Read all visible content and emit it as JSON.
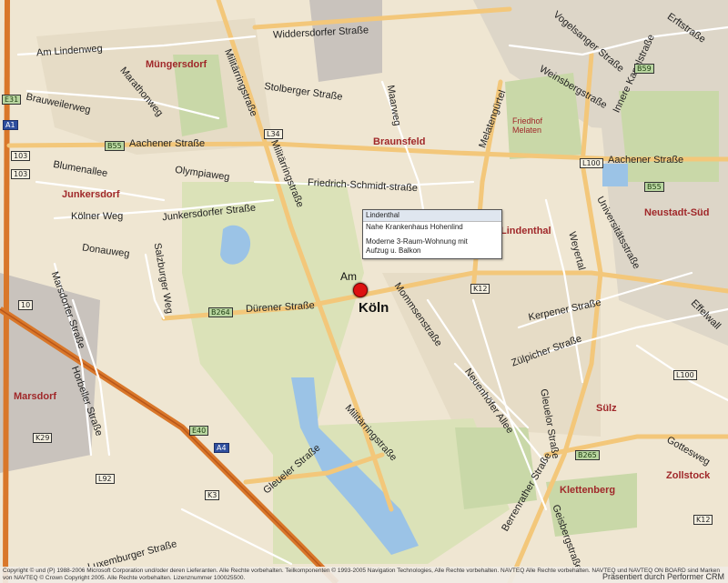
{
  "colors": {
    "land": "#efe6d2",
    "park": "#c9d8a8",
    "urban": "#c9c3bd",
    "water": "#9bc3e6",
    "major_road": "#f3c77a",
    "minor_road": "#ffffff",
    "highway": "#d9772a",
    "district_label": "#a0282a"
  },
  "streets": [
    "Widdersdorfer Straße",
    "Am Lindenweg",
    "Marathonweg",
    "Brauweilerweg",
    "Militärringstraße",
    "Stolberger Straße",
    "Maarweg",
    "Aachener Straße",
    "Olympiaweg",
    "Blumenallee",
    "Friedrich-Schmidt-straße",
    "Junkersdorfer Straße",
    "Kölner Weg",
    "Donauweg",
    "Salzburger Weg",
    "Dürener Straße",
    "Mommsenstraße",
    "Gleueler Straße",
    "Kerpener Straße",
    "Zülpicher Straße",
    "Weyertal",
    "Universitätsstraße",
    "Neuenhöfer Allee",
    "Berrenrather Straße",
    "Gottesweg",
    "Effelwall",
    "Vogelsanger Straße",
    "Weinsbergstraße",
    "Innere Kanalstraße",
    "Melatengürtel",
    "Horbeller Straße",
    "Marsdorfer Straße",
    "Luxemburger Straße",
    "Erftstraße",
    "Gleuelor Straße",
    "Geisbergstraße",
    "Militärringstraße",
    "Militärringstraße",
    "Aachener Straße"
  ],
  "districts": [
    "Müngersdorf",
    "Braunsfeld",
    "Junkersdorf",
    "Lindenthal",
    "Neustadt-Süd",
    "Marsdorf",
    "Sülz",
    "Klettenberg",
    "Zollstock",
    "Friedhof Melaten"
  ],
  "shields": [
    {
      "label": "E31",
      "style": "g"
    },
    {
      "label": "A1",
      "style": "b"
    },
    {
      "label": "103",
      "style": "w"
    },
    {
      "label": "103",
      "style": "w"
    },
    {
      "label": "B55",
      "style": "g"
    },
    {
      "label": "B55",
      "style": "g"
    },
    {
      "label": "L34",
      "style": "w"
    },
    {
      "label": "L100",
      "style": "w"
    },
    {
      "label": "B59",
      "style": "g"
    },
    {
      "label": "B264",
      "style": "g"
    },
    {
      "label": "K12",
      "style": "w"
    },
    {
      "label": "10",
      "style": "w"
    },
    {
      "label": "E40",
      "style": "g"
    },
    {
      "label": "A4",
      "style": "b"
    },
    {
      "label": "K29",
      "style": "w"
    },
    {
      "label": "L92",
      "style": "w"
    },
    {
      "label": "K3",
      "style": "w"
    },
    {
      "label": "L100",
      "style": "w"
    },
    {
      "label": "B265",
      "style": "g"
    },
    {
      "label": "K12",
      "style": "w"
    }
  ],
  "marker": {
    "city": "Köln",
    "am_label": "Am",
    "popup_title": "Lindenthal",
    "popup_line1": "Nahe Krankenhaus Hohenlind",
    "popup_line2": "Moderne 3-Raum-Wohnung mit",
    "popup_line3": "Aufzug u. Balkon"
  },
  "footer": {
    "copyright": "Copyright © und (P) 1988-2006 Microsoft Corporation und/oder deren Lieferanten. Alle Rechte vorbehalten. Teilkomponenten © 1993-2005 Navigation Technologies, Alle Rechte vorbehalten. NAVTEQ Alle Rechte vorbehalten. NAVTEQ und NAVTEQ ON BOARD sind Marken von NAVTEQ © Crown Copyright 2005. Alle Rechte vorbehalten. Lizenznummer 100025500.",
    "brand": "Präsentiert durch Performer CRM"
  }
}
